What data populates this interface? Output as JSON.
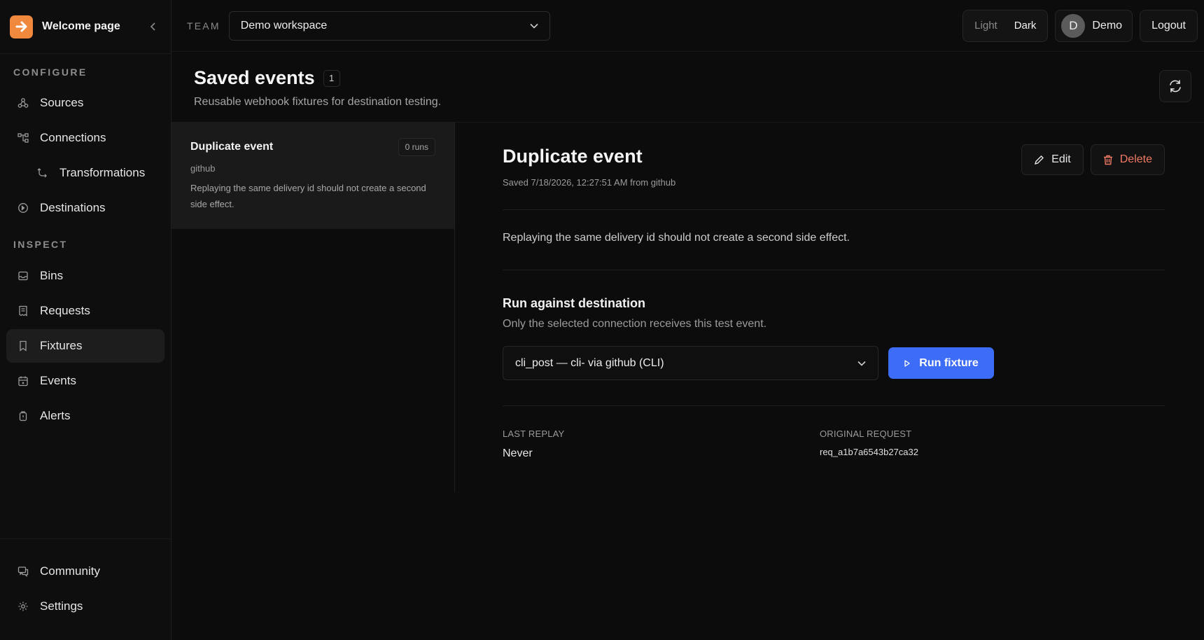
{
  "sidebar": {
    "brand_title": "Welcome page",
    "sections": {
      "configure": "CONFIGURE",
      "inspect": "INSPECT"
    },
    "items": [
      {
        "label": "Sources",
        "icon": "webhook-icon"
      },
      {
        "label": "Connections",
        "icon": "connections-icon"
      },
      {
        "label": "Transformations",
        "icon": "transform-icon"
      },
      {
        "label": "Destinations",
        "icon": "destination-icon"
      },
      {
        "label": "Bins",
        "icon": "inbox-icon"
      },
      {
        "label": "Requests",
        "icon": "receipt-icon"
      },
      {
        "label": "Fixtures",
        "icon": "bookmark-icon"
      },
      {
        "label": "Events",
        "icon": "calendar-icon"
      },
      {
        "label": "Alerts",
        "icon": "bell-icon"
      },
      {
        "label": "Community",
        "icon": "chat-icon"
      },
      {
        "label": "Settings",
        "icon": "gear-icon"
      }
    ]
  },
  "topbar": {
    "team_label": "TEAM",
    "team_value": "Demo workspace",
    "theme_light": "Light",
    "theme_dark": "Dark",
    "user_initial": "D",
    "user_name": "Demo",
    "logout": "Logout"
  },
  "page": {
    "title": "Saved events",
    "count": "1",
    "subtitle": "Reusable webhook fixtures for destination testing."
  },
  "fixtures": [
    {
      "title": "Duplicate event",
      "runs": "0 runs",
      "source": "github",
      "description": "Replaying the same delivery id should not create a second side effect."
    }
  ],
  "detail": {
    "title": "Duplicate event",
    "meta": "Saved 7/18/2026, 12:27:51 AM from github",
    "edit": "Edit",
    "delete": "Delete",
    "description": "Replaying the same delivery id should not create a second side effect.",
    "run_title": "Run against destination",
    "run_subtitle": "Only the selected connection receives this test event.",
    "destination": "cli_post — cli- via github (CLI)",
    "run_button": "Run fixture",
    "last_replay_label": "LAST REPLAY",
    "last_replay_value": "Never",
    "original_request_label": "ORIGINAL REQUEST",
    "original_request_value": "req_a1b7a6543b27ca32"
  },
  "colors": {
    "accent": "#3d6cf7",
    "brand": "#f0883e",
    "danger": "#f07a64"
  }
}
